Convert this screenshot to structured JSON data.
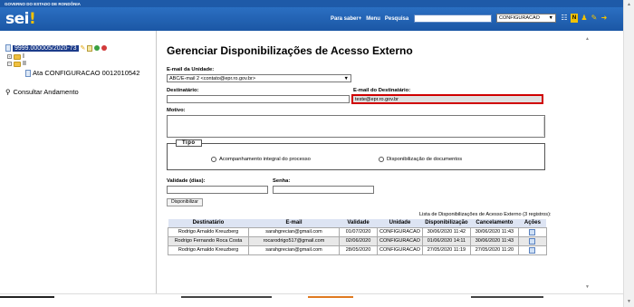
{
  "header": {
    "gov_title": "GOVERNO DO ESTADO DE RONDÔNIA",
    "logo": "sei",
    "nav": [
      "Para saber+",
      "Menu",
      "Pesquisa"
    ],
    "unit_selected": "CONFIGURACAO",
    "icons": [
      "grid-icon",
      "notes-icon",
      "user-icon",
      "tools-icon",
      "exit-icon"
    ]
  },
  "tree": {
    "process": "9999.000005/2020-73",
    "folder1": "I",
    "folder2": "II",
    "document": "Ata CONFIGURACAO 0012010542",
    "consult": "Consultar Andamento"
  },
  "form": {
    "title": "Gerenciar Disponibilizações de Acesso Externo",
    "email_unit_label": "E-mail da Unidade:",
    "email_unit_value": "ABC/E-mail 2 <contato@epr.ro.gov.br>",
    "dest_label": "Destinatário:",
    "dest_email_label": "E-mail do Destinatário:",
    "dest_email_value": "teste@epr.ro.gov.br",
    "motivo_label": "Motivo:",
    "tipo_label": "Tipo",
    "tipo_options": [
      "Acompanhamento integral do processo",
      "Disponibilização de documentos"
    ],
    "validade_label": "Validade (dias):",
    "senha_label": "Senha:",
    "button_label": "Disponibilizar"
  },
  "table": {
    "caption": "Lista de Disponibilizações de Acesso Externo (3 registros):",
    "headers": [
      "Destinatário",
      "E-mail",
      "Validade",
      "Unidade",
      "Disponibilização",
      "Cancelamento",
      "Ações"
    ],
    "rows": [
      [
        "Rodrigo Arnaldo Kreuzberg",
        "sarahgrecian@gmail.com",
        "01/07/2020",
        "CONFIGURACAO",
        "30/06/2020 11:42",
        "30/06/2020 11:43"
      ],
      [
        "Rodrigo Fernando Roca Costa",
        "rocarodrigo517@gmail.com",
        "02/06/2020",
        "CONFIGURACAO",
        "01/06/2020 14:11",
        "30/06/2020 11:43"
      ],
      [
        "Rodrigo Arnaldo Kreuzberg",
        "sarahgrecian@gmail.com",
        "28/05/2020",
        "CONFIGURACAO",
        "27/05/2020 11:19",
        "27/05/2020 11:20"
      ]
    ]
  }
}
